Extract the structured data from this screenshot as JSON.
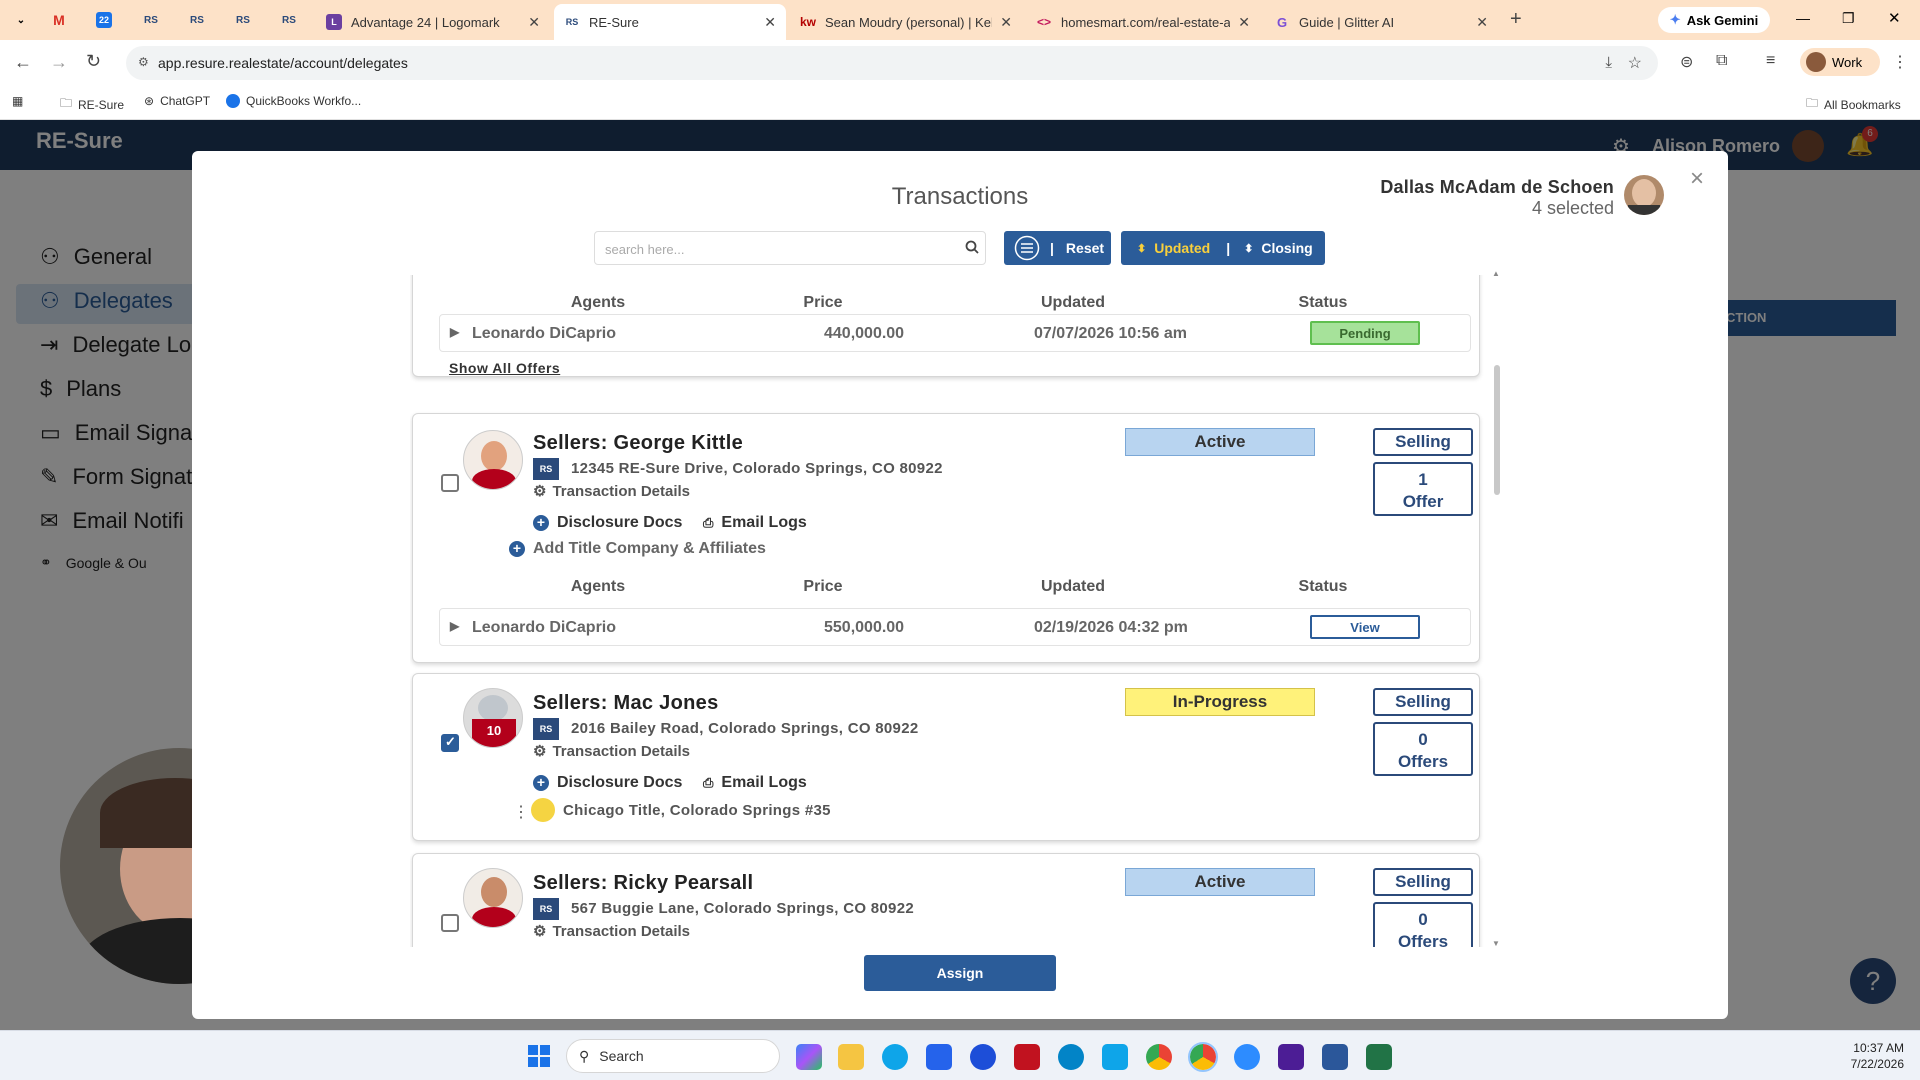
{
  "browser": {
    "tabs": [
      {
        "title": "Advantage 24 | Logomark",
        "favicon": "L",
        "color": "#6b3fa0"
      },
      {
        "title": "RE-Sure",
        "favicon": "RS",
        "color": "#2b4a7a",
        "active": true
      },
      {
        "title": "Sean Moudry (personal) | Keller",
        "favicon": "kw",
        "color": "#b40101"
      },
      {
        "title": "homesmart.com/real-estate-ag",
        "favicon": "<>",
        "color": "#c2185b"
      },
      {
        "title": "Guide | Glitter AI",
        "favicon": "G",
        "color": "#7b4fd6"
      }
    ],
    "pinned_tabs": [
      "M",
      "22",
      "RS",
      "RS",
      "RS",
      "RS"
    ],
    "gemini_label": "Ask Gemini",
    "url": "app.resure.realestate/account/delegates",
    "profile_label": "Work",
    "bookmarks": [
      "RE-Sure",
      "ChatGPT",
      "QuickBooks Workfo..."
    ],
    "all_bookmarks": "All Bookmarks"
  },
  "app": {
    "logo": "RE-Sure",
    "user": "Alison Romero",
    "notifications": "6",
    "sidebar": [
      "General",
      "Delegates",
      "Delegate Lo",
      "Plans",
      "Email Signat",
      "Form Signat",
      "Email Notifi"
    ],
    "integrations": "Google  &  Ou",
    "section_btn": "CTION"
  },
  "modal": {
    "title": "Transactions",
    "user_name": "Dallas McAdam de Schoen",
    "selected_text": "4 selected",
    "search_placeholder": "search here...",
    "reset_label": "Reset",
    "sort_updated": "Updated",
    "sort_closing": "Closing",
    "assign_label": "Assign",
    "headers": {
      "agents": "Agents",
      "price": "Price",
      "updated": "Updated",
      "status": "Status"
    },
    "first_card": {
      "agent": "Leonardo DiCaprio",
      "price": "440,000.00",
      "updated": "07/07/2026 10:56 am",
      "status": "Pending",
      "show_all": "Show All Offers"
    },
    "cards": [
      {
        "seller": "Sellers: George Kittle",
        "address": "12345 RE-Sure Drive, Colorado Springs, CO 80922",
        "details": "Transaction Details",
        "disclosure": "Disclosure Docs",
        "email_logs": "Email Logs",
        "title_co": "Add Title Company & Affiliates",
        "status": "Active",
        "side": "Selling",
        "offer_count": "1",
        "offer_label": "Offer",
        "checked": false,
        "offer_row": {
          "agent": "Leonardo DiCaprio",
          "price": "550,000.00",
          "updated": "02/19/2026 04:32 pm",
          "status": "View"
        }
      },
      {
        "seller": "Sellers: Mac Jones",
        "address": "2016 Bailey Road, Colorado Springs, CO 80922",
        "details": "Transaction Details",
        "disclosure": "Disclosure Docs",
        "email_logs": "Email Logs",
        "title_co": "Chicago Title, Colorado Springs #35",
        "status": "In-Progress",
        "side": "Selling",
        "offer_count": "0",
        "offer_label": "Offers",
        "checked": true
      },
      {
        "seller": "Sellers: Ricky Pearsall",
        "address": "567 Buggie Lane, Colorado Springs, CO 80922",
        "details": "Transaction Details",
        "status": "Active",
        "side": "Selling",
        "offer_count": "0",
        "offer_label": "Offers",
        "checked": false
      }
    ]
  },
  "taskbar": {
    "search": "Search",
    "time": "10:37 AM",
    "date": "7/22/2026"
  },
  "colors": {
    "accent": "#2b5c99",
    "active_bg": "#b8d4f0",
    "progress_bg": "#fff27a",
    "pending_bg": "#a6e29a"
  }
}
